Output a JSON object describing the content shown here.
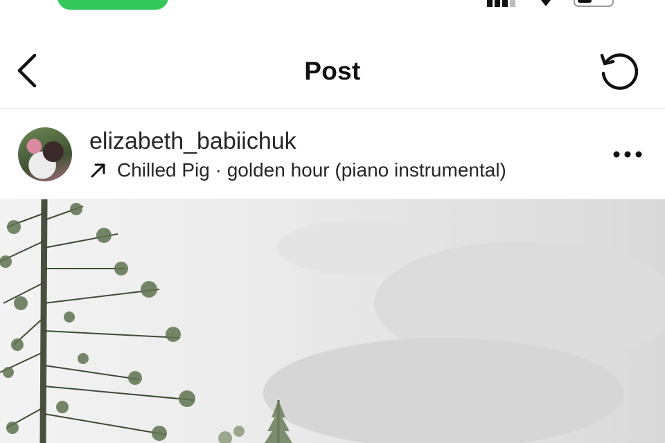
{
  "colors": {
    "call_pill": "#34c759",
    "text_primary": "#111111",
    "divider": "#e6e6e6"
  },
  "nav": {
    "title": "Post",
    "back_icon": "chevron-left-icon",
    "refresh_icon": "refresh-icon"
  },
  "post": {
    "username": "elizabeth_babiichuk",
    "audio_icon": "arrow-up-right-icon",
    "audio": "Chilled Pig · golden hour (piano instrumental)",
    "more_icon": "more-horizontal-icon",
    "image_alt": "pine trees under a cloudy sky"
  }
}
